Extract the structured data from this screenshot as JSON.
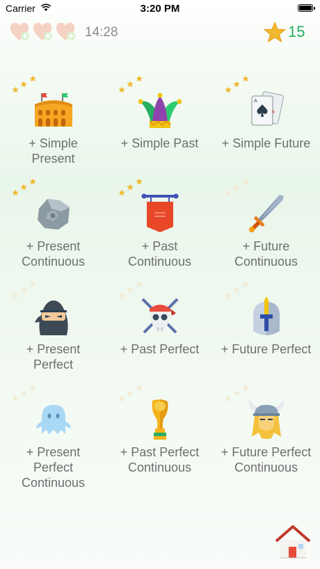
{
  "status": {
    "carrier": "Carrier",
    "time": "3:20 PM"
  },
  "hud": {
    "timer": "14:28",
    "score": "15",
    "hearts": 3
  },
  "lessons": [
    {
      "lines": [
        "+ Simple",
        "Present"
      ],
      "icon": "colosseum-icon",
      "stars_earned": 3
    },
    {
      "lines": [
        "+ Simple Past"
      ],
      "icon": "jester-hat-icon",
      "stars_earned": 3
    },
    {
      "lines": [
        "+ Simple Future"
      ],
      "icon": "playing-cards-icon",
      "stars_earned": 3
    },
    {
      "lines": [
        "+ Present",
        "Continuous"
      ],
      "icon": "rock-icon",
      "stars_earned": 3
    },
    {
      "lines": [
        "+ Past",
        "Continuous"
      ],
      "icon": "banner-icon",
      "stars_earned": 3
    },
    {
      "lines": [
        "+ Future",
        "Continuous"
      ],
      "icon": "sword-icon",
      "stars_earned": 0
    },
    {
      "lines": [
        "+ Present",
        "Perfect"
      ],
      "icon": "ninja-icon",
      "stars_earned": 0
    },
    {
      "lines": [
        "+ Past Perfect"
      ],
      "icon": "pirate-skull-icon",
      "stars_earned": 0
    },
    {
      "lines": [
        "+ Future Perfect"
      ],
      "icon": "knight-helmet-icon",
      "stars_earned": 0
    },
    {
      "lines": [
        "+ Present",
        "Perfect",
        "Continuous"
      ],
      "icon": "ghost-icon",
      "stars_earned": 0
    },
    {
      "lines": [
        "+ Past Perfect",
        "Continuous"
      ],
      "icon": "trophy-cup-icon",
      "stars_earned": 0
    },
    {
      "lines": [
        "+ Future Perfect",
        "Continuous"
      ],
      "icon": "viking-helmet-icon",
      "stars_earned": 0
    }
  ],
  "colors": {
    "gold_star": "#f1b82d",
    "faded_star": "#f2ead2",
    "score_green": "#27ae60"
  }
}
